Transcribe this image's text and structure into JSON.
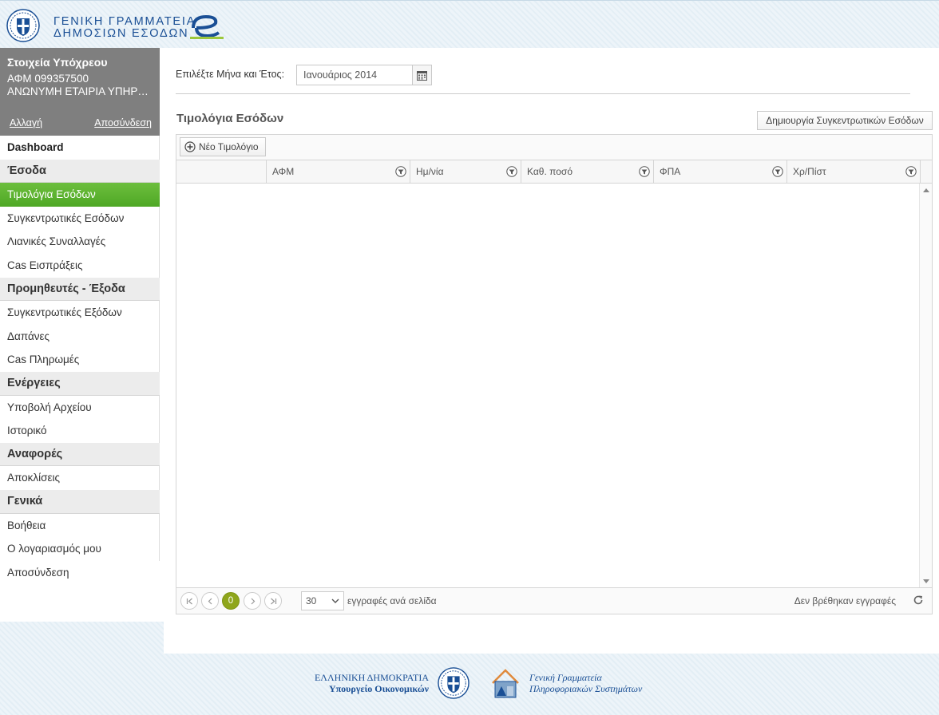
{
  "header": {
    "title_line1": "ΓΕΝΙΚΗ ΓΡΑΜΜΑΤΕΙΑ",
    "title_line2": "ΔΗΜΟΣΙΩΝ ΕΣΟΔΩΝ"
  },
  "user": {
    "title": "Στοιχεία Υπόχρεου",
    "afm": "ΑΦΜ 099357500",
    "name": "ΑΝΩΝΥΜΗ ΕΤΑΙΡΙΑ ΥΠΗΡΕΣΙΩΝ",
    "change_link": "Αλλαγή",
    "logout_link": "Αποσύνδεση"
  },
  "nav": {
    "dashboard": "Dashboard",
    "sections": [
      {
        "title": "Έσοδα",
        "items": [
          "Τιμολόγια Εσόδων",
          "Συγκεντρωτικές Εσόδων",
          "Λιανικές Συναλλαγές",
          "Cas Εισπράξεις"
        ]
      },
      {
        "title": "Προμηθευτές - Έξοδα",
        "items": [
          "Συγκεντρωτικές Εξόδων",
          "Δαπάνες",
          "Cas Πληρωμές"
        ]
      },
      {
        "title": "Ενέργειες",
        "items": [
          "Υποβολή Αρχείου",
          "Ιστορικό"
        ]
      },
      {
        "title": "Αναφορές",
        "items": [
          "Αποκλίσεις"
        ]
      },
      {
        "title": "Γενικά",
        "items": [
          "Βοήθεια",
          "Ο λογαριασμός μου",
          "Αποσύνδεση"
        ]
      }
    ],
    "active_item": "Τιμολόγια Εσόδων"
  },
  "main": {
    "period_label": "Επιλέξτε Μήνα και Έτος:",
    "period_value": "Ιανουάριος 2014",
    "section_title": "Τιμολόγια Εσόδων",
    "create_button": "Δημιουργία Συγκεντρωτικών Εσόδων",
    "new_invoice_button": "Νέο Τιμολόγιο",
    "columns": [
      "",
      "ΑΦΜ",
      "Ημ/νία",
      "Καθ. ποσό",
      "ΦΠΑ",
      "Χρ/Πίστ"
    ],
    "pager": {
      "current_page": "0",
      "page_size": "30",
      "page_size_label": "εγγραφές ανά σελίδα",
      "info": "Δεν βρέθηκαν εγγραφές"
    }
  },
  "footer": {
    "left_line1": "ΕΛΛΗΝΙΚΗ ΔΗΜΟΚΡΑΤΙΑ",
    "left_line2": "Υπουργείο Οικονομικών",
    "right_line1": "Γενική Γραμματεία",
    "right_line2": "Πληροφοριακών Συστημάτων"
  },
  "colors": {
    "brand_blue": "#1a4f95",
    "active_green": "#5cb230",
    "pager_current": "#8fa61c",
    "user_box": "#7f7f7f"
  }
}
